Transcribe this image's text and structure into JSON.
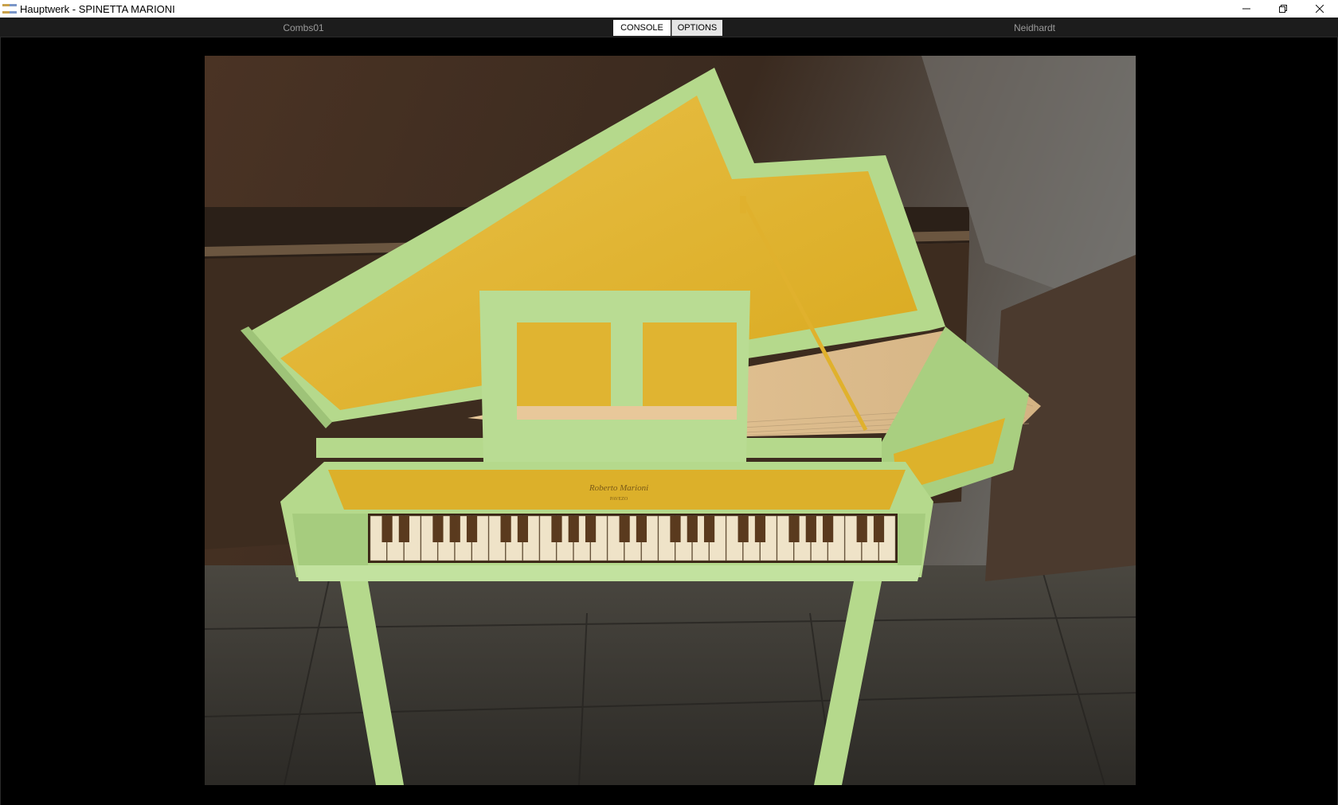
{
  "window": {
    "title": "Hauptwerk - SPINETTA MARIONI",
    "minimize_glyph": "—",
    "restore_glyph": "❐",
    "close_glyph": "✕"
  },
  "toolbar": {
    "combination_label": "Combs01",
    "temperament_label": "Neidhardt",
    "tabs": [
      {
        "label": "CONSOLE",
        "active": true
      },
      {
        "label": "OPTIONS",
        "active": false
      }
    ]
  },
  "console": {
    "nameboard_text": "Roberto Marioni",
    "nameboard_subtext": "PAVEZO",
    "colors": {
      "case_green": "#b5d98c",
      "lid_yellow": "#e1b52c",
      "background_brown": "#3a2a1e",
      "floor": "#56524a"
    }
  },
  "icons": {
    "app": "hauptwerk-app-icon",
    "minimize": "minimize-icon",
    "restore": "restore-icon",
    "close": "close-icon"
  }
}
